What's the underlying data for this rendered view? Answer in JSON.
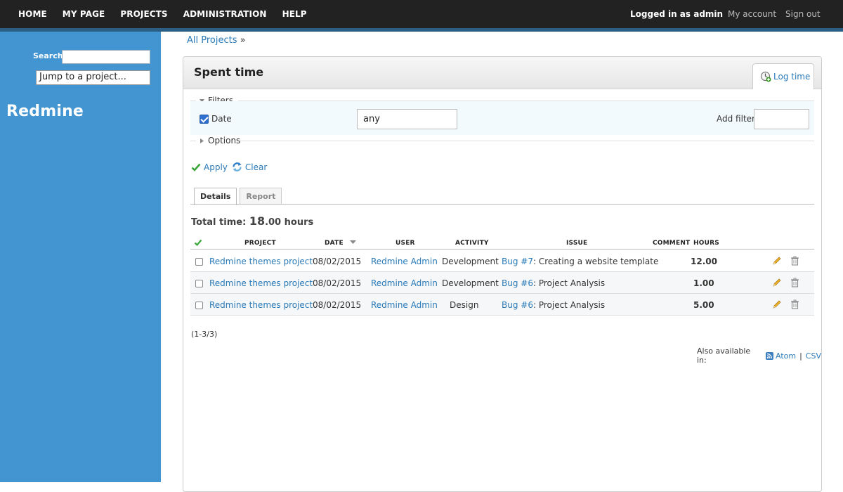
{
  "top_menu": {
    "items": [
      "HOME",
      "MY PAGE",
      "PROJECTS",
      "ADMINISTRATION",
      "HELP"
    ],
    "logged_in_text": "Logged in as admin",
    "my_account": "My account",
    "sign_out": "Sign out"
  },
  "sidebar": {
    "search_label": "Search:",
    "search_value": "",
    "jump_label": "Jump to a project...",
    "site_title": "Redmine"
  },
  "breadcrumb": {
    "link": "All Projects",
    "sep": "»"
  },
  "page": {
    "title": "Spent time",
    "log_time_label": "Log time"
  },
  "filters": {
    "legend": "Filters",
    "date_label": "Date",
    "date_checked": true,
    "date_value": "any",
    "add_filter_label": "Add filter",
    "options_legend": "Options"
  },
  "actions": {
    "apply": "Apply",
    "clear": "Clear"
  },
  "tabs": [
    "Details",
    "Report"
  ],
  "total": {
    "label": "Total time:",
    "whole": "18",
    "fraction": ".00",
    "unit": "hours"
  },
  "table": {
    "columns": [
      "PROJECT",
      "DATE",
      "USER",
      "ACTIVITY",
      "ISSUE",
      "COMMENT",
      "HOURS"
    ],
    "rows": [
      {
        "project": "Redmine themes project",
        "date": "08/02/2015",
        "user": "Redmine Admin",
        "activity": "Development",
        "issue_link": "Bug #7",
        "issue_title": ": Creating a website template",
        "hours": "12.00"
      },
      {
        "project": "Redmine themes project",
        "date": "08/02/2015",
        "user": "Redmine Admin",
        "activity": "Development",
        "issue_link": "Bug #6",
        "issue_title": ": Project Analysis",
        "hours": "1.00"
      },
      {
        "project": "Redmine themes project",
        "date": "08/02/2015",
        "user": "Redmine Admin",
        "activity": "Design",
        "issue_link": "Bug #6",
        "issue_title": ": Project Analysis",
        "hours": "5.00"
      }
    ]
  },
  "pagination": "(1-3/3)",
  "formats": {
    "label": "Also available in:",
    "atom": "Atom",
    "sep": "|",
    "csv": "CSV"
  },
  "colors": {
    "link": "#2a7ab8",
    "sidebar": "#4295d1",
    "topbar": "#222222"
  }
}
